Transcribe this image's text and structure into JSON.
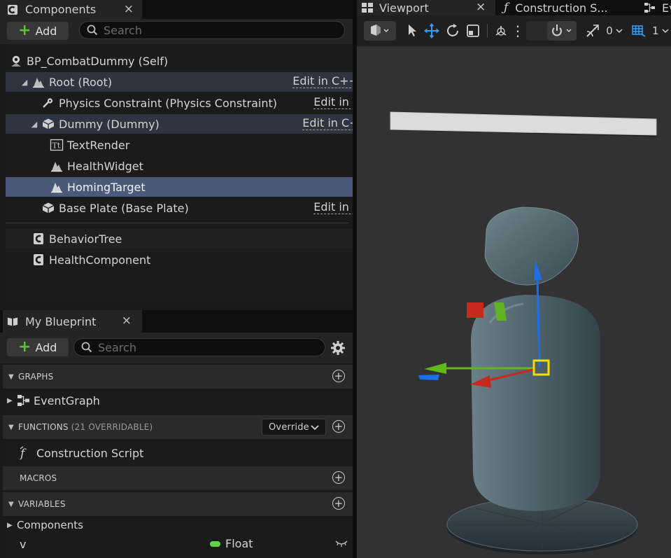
{
  "components_panel": {
    "tab_title": "Components",
    "close_glyph": "×",
    "add_label": "Add",
    "search_placeholder": "Search",
    "edit_link": "Edit in C++",
    "tree": [
      {
        "label": "BP_CombatDummy (Self)",
        "icon": "blueprint-self-icon"
      },
      {
        "label": "Root (Root)",
        "icon": "scene-component-icon",
        "edit": true,
        "expanded": true
      },
      {
        "label": "Physics Constraint (Physics Constraint)",
        "icon": "physics-constraint-icon",
        "edit": true
      },
      {
        "label": "Dummy (Dummy)",
        "icon": "static-mesh-icon",
        "edit": true,
        "expanded": true
      },
      {
        "label": "TextRender",
        "icon": "text-render-icon"
      },
      {
        "label": "HealthWidget",
        "icon": "scene-component-icon"
      },
      {
        "label": "HomingTarget",
        "icon": "scene-component-icon",
        "selected": true
      },
      {
        "label": "Base Plate (Base Plate)",
        "icon": "static-mesh-icon",
        "edit": true
      },
      {
        "label": "BehaviorTree",
        "icon": "actor-component-icon"
      },
      {
        "label": "HealthComponent",
        "icon": "actor-component-icon"
      }
    ]
  },
  "my_blueprint_panel": {
    "tab_title": "My Blueprint",
    "close_glyph": "×",
    "add_label": "Add",
    "search_placeholder": "Search",
    "sections": {
      "graphs": "GRAPHS",
      "functions": "FUNCTIONS",
      "functions_note": "(21 OVERRIDABLE)",
      "macros": "MACROS",
      "variables": "VARIABLES"
    },
    "override_label": "Override",
    "items": {
      "event_graph": "EventGraph",
      "construction_script": "Construction Script",
      "components_group": "Components",
      "variable_name": "v",
      "variable_type": "Float"
    },
    "colors": {
      "float_pin": "#5fd448"
    }
  },
  "viewport_panel": {
    "tabs": [
      {
        "label": "Viewport",
        "active": true,
        "close": "×"
      },
      {
        "label": "Construction S...",
        "active": false
      },
      {
        "label": "Ev",
        "active": false
      }
    ],
    "toolbar": {
      "rotation_snap_value": "0",
      "grid_value": "1"
    },
    "colors": {
      "axis_x": "#c62a1c",
      "axis_y": "#62b818",
      "axis_z": "#1e6fe6",
      "pivot": "#f2e000",
      "dummy_body": "#4a5d66"
    }
  }
}
